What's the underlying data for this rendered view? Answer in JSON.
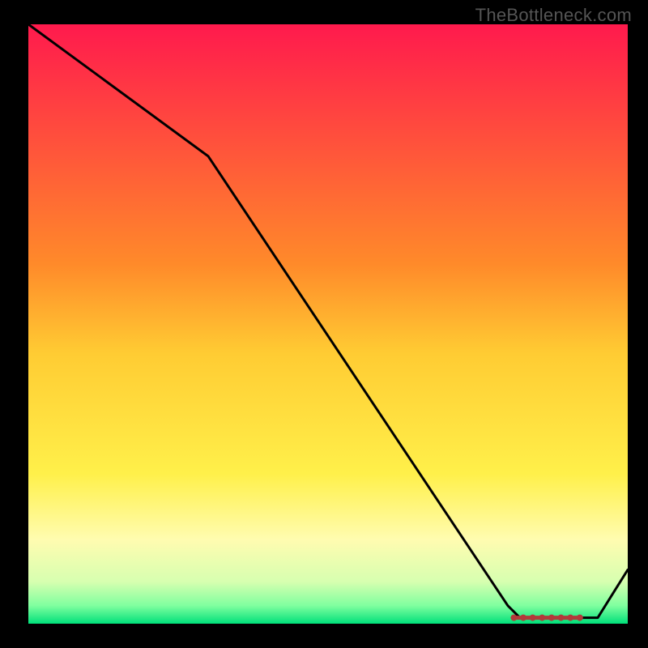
{
  "watermark": "TheBottleneck.com",
  "chart_data": {
    "type": "line",
    "title": "",
    "xlabel": "",
    "ylabel": "",
    "xlim": [
      0,
      100
    ],
    "ylim": [
      0,
      100
    ],
    "x": [
      0,
      30,
      80,
      82,
      86,
      89,
      91,
      93,
      95,
      100
    ],
    "values": [
      100,
      78,
      3,
      1,
      1,
      1,
      1,
      1,
      1,
      9
    ],
    "marker_band": {
      "x_start": 81,
      "x_end": 92,
      "y": 1
    },
    "background_gradient_stops": [
      {
        "pos": 0.0,
        "color": "#ff1a4d"
      },
      {
        "pos": 0.4,
        "color": "#ff8a2a"
      },
      {
        "pos": 0.55,
        "color": "#ffcc33"
      },
      {
        "pos": 0.75,
        "color": "#fff04a"
      },
      {
        "pos": 0.86,
        "color": "#fffcb0"
      },
      {
        "pos": 0.93,
        "color": "#d7ffb0"
      },
      {
        "pos": 0.97,
        "color": "#7fff9f"
      },
      {
        "pos": 1.0,
        "color": "#00e07a"
      }
    ]
  }
}
